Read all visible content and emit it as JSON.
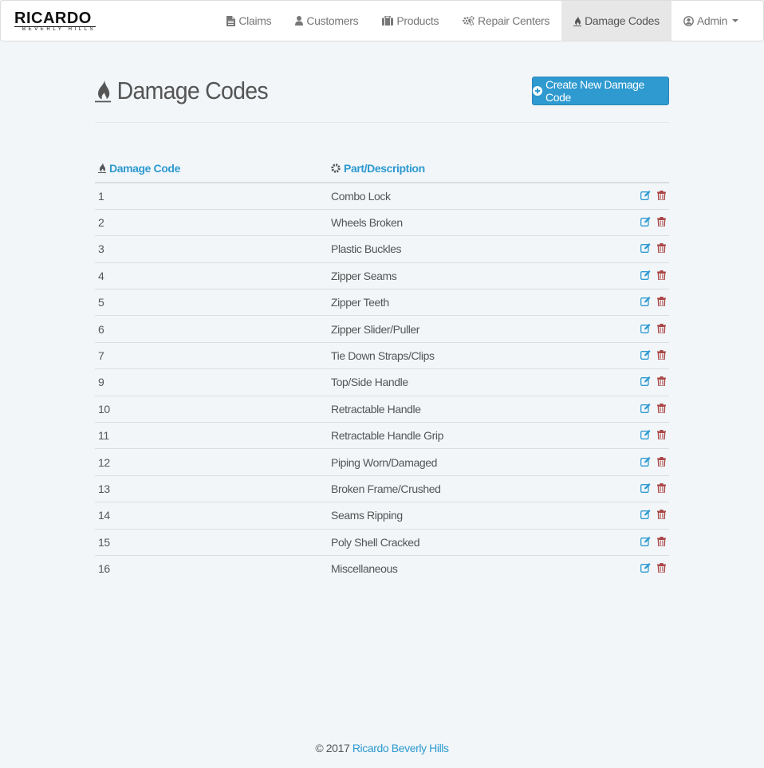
{
  "brand": {
    "name": "RICARDO",
    "sub": "BEVERLY HILLS"
  },
  "nav": {
    "items": [
      {
        "label": "Claims",
        "icon": "file-icon"
      },
      {
        "label": "Customers",
        "icon": "user-icon"
      },
      {
        "label": "Products",
        "icon": "briefcase-icon"
      },
      {
        "label": "Repair Centers",
        "icon": "gears-icon"
      },
      {
        "label": "Damage Codes",
        "icon": "fire-icon",
        "active": true
      },
      {
        "label": "Admin",
        "icon": "user-circle-icon",
        "dropdown": true
      }
    ]
  },
  "page": {
    "title": "Damage Codes",
    "create_button": "Create New Damage Code"
  },
  "table": {
    "headers": {
      "code": "Damage Code",
      "description": "Part/Description"
    },
    "rows": [
      {
        "code": "1",
        "description": "Combo Lock"
      },
      {
        "code": "2",
        "description": "Wheels Broken"
      },
      {
        "code": "3",
        "description": "Plastic Buckles"
      },
      {
        "code": "4",
        "description": "Zipper Seams"
      },
      {
        "code": "5",
        "description": "Zipper Teeth"
      },
      {
        "code": "6",
        "description": "Zipper Slider/Puller"
      },
      {
        "code": "7",
        "description": "Tie Down Straps/Clips"
      },
      {
        "code": "9",
        "description": "Top/Side Handle"
      },
      {
        "code": "10",
        "description": "Retractable Handle"
      },
      {
        "code": "11",
        "description": "Retractable Handle Grip"
      },
      {
        "code": "12",
        "description": "Piping Worn/Damaged"
      },
      {
        "code": "13",
        "description": "Broken Frame/Crushed"
      },
      {
        "code": "14",
        "description": "Seams Ripping"
      },
      {
        "code": "15",
        "description": "Poly Shell Cracked"
      },
      {
        "code": "16",
        "description": "Miscellaneous"
      }
    ]
  },
  "footer": {
    "copyright": "© 2017",
    "link": "Ricardo Beverly Hills"
  },
  "colors": {
    "accent": "#2e9ad0",
    "delete": "#a94442",
    "background": "#f2f6f9"
  }
}
